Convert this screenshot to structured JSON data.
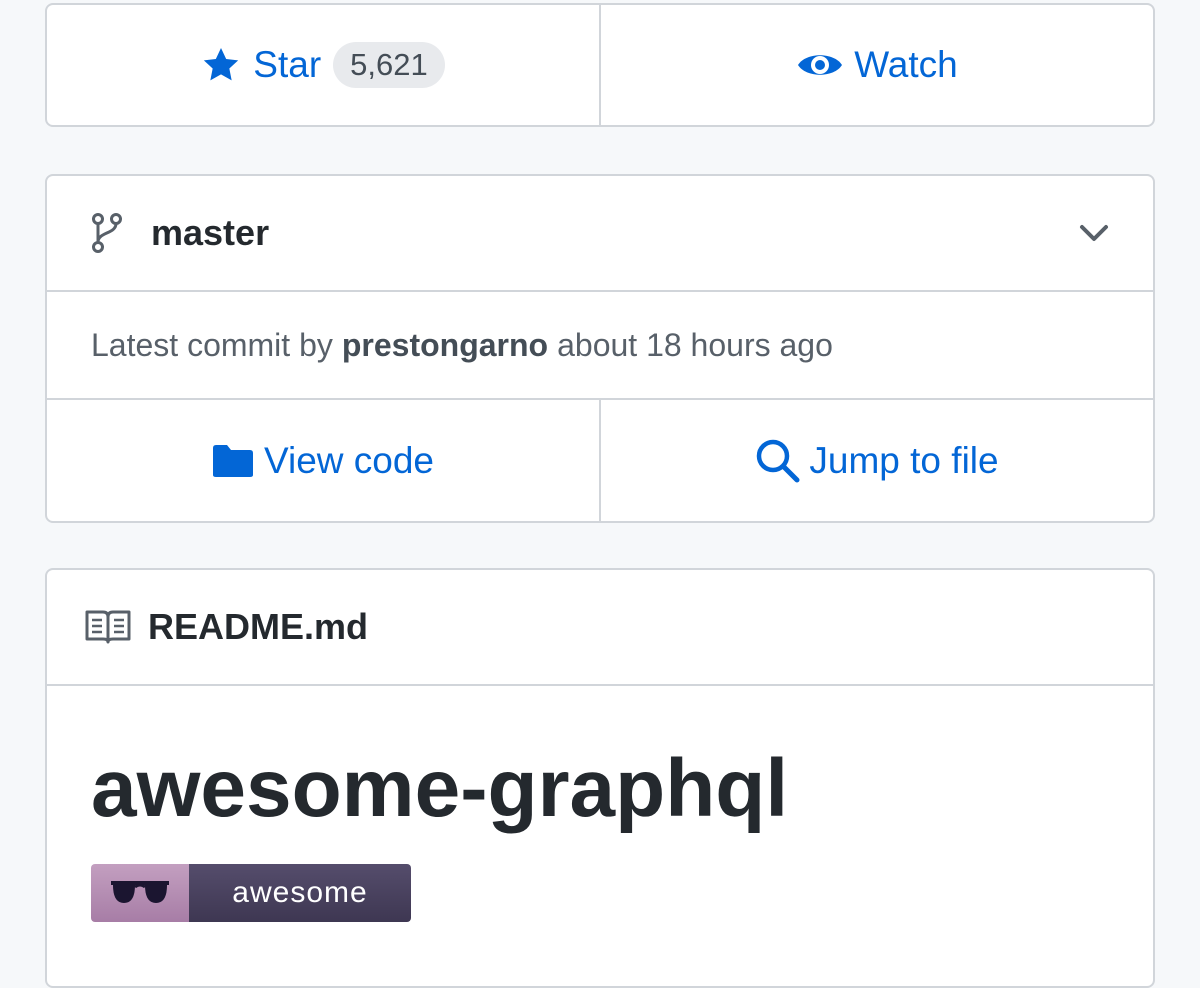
{
  "actions": {
    "star_label": "Star",
    "star_count": "5,621",
    "watch_label": "Watch"
  },
  "branch": {
    "name": "master"
  },
  "commit": {
    "prefix": "Latest commit by",
    "author": "prestongarno",
    "time": "about 18 hours ago"
  },
  "code_actions": {
    "view_code": "View code",
    "jump_to_file": "Jump to file"
  },
  "readme": {
    "filename": "README.md",
    "title": "awesome-graphql",
    "badge_text": "awesome"
  },
  "colors": {
    "accent": "#0366d6",
    "border": "#d1d5da",
    "background": "#f6f8fa"
  },
  "icons": [
    "star-icon",
    "eye-icon",
    "git-branch-icon",
    "chevron-down-icon",
    "folder-icon",
    "search-icon",
    "book-icon",
    "sunglasses-icon"
  ]
}
